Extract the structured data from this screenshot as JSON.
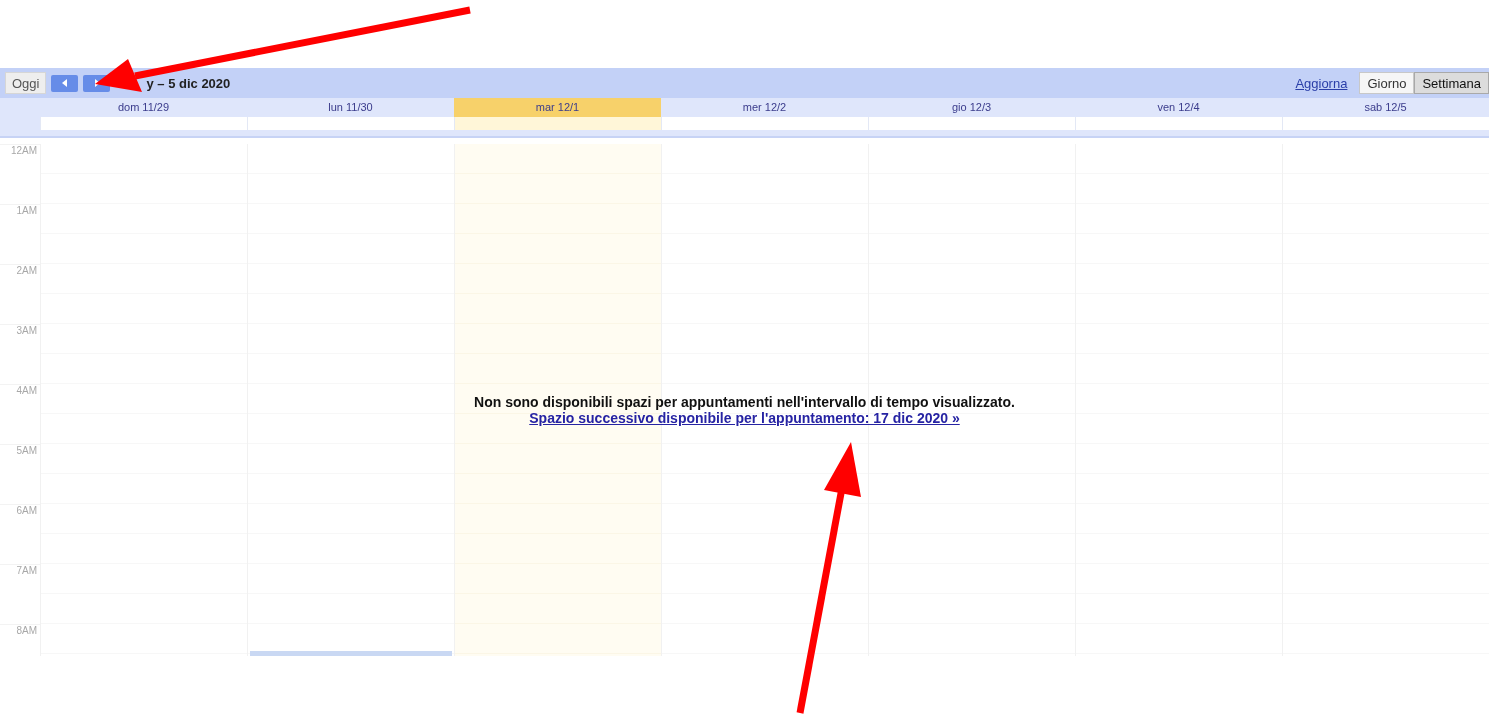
{
  "toolbar": {
    "today_button": "Oggi",
    "date_range": "y – 5 dic 2020",
    "refresh_link": "Aggiorna",
    "view_tabs": [
      {
        "label": "Giorno",
        "selected": false
      },
      {
        "label": "Settimana",
        "selected": true
      }
    ]
  },
  "days": [
    {
      "label": "dom 11/29",
      "today": false,
      "has_event": false
    },
    {
      "label": "lun 11/30",
      "today": false,
      "has_event": true
    },
    {
      "label": "mar 12/1",
      "today": true,
      "has_event": false
    },
    {
      "label": "mer 12/2",
      "today": false,
      "has_event": false
    },
    {
      "label": "gio 12/3",
      "today": false,
      "has_event": false
    },
    {
      "label": "ven 12/4",
      "today": false,
      "has_event": false
    },
    {
      "label": "sab 12/5",
      "today": false,
      "has_event": false
    }
  ],
  "hours": [
    "12AM",
    "1AM",
    "2AM",
    "3AM",
    "4AM",
    "5AM",
    "6AM",
    "7AM",
    "8AM"
  ],
  "notice": "Non sono disponibili spazi per appuntamenti nell'intervallo di tempo visualizzato.",
  "next_slot_link": "Spazio successivo disponibile per l'appuntamento: 17 dic 2020 »"
}
